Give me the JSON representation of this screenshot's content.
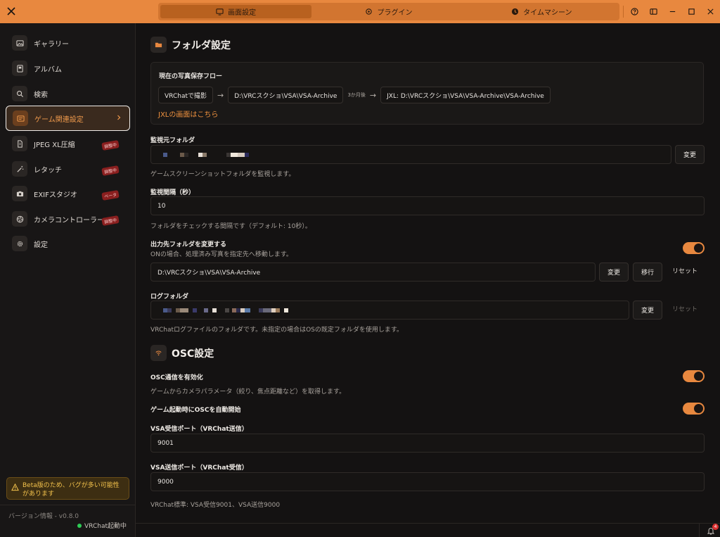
{
  "titlebar": {
    "tabs": [
      {
        "label": "画面設定",
        "icon": "monitor-icon",
        "active": true
      },
      {
        "label": "プラグイン",
        "icon": "puzzle-icon",
        "active": false
      },
      {
        "label": "タイムマシーン",
        "icon": "clock-icon",
        "active": false
      }
    ],
    "icons": [
      "help-icon",
      "sidebar-toggle-icon",
      "minimize-icon",
      "maximize-icon",
      "close-icon"
    ]
  },
  "sidebar": {
    "items": [
      {
        "label": "ギャラリー",
        "icon": "image-icon"
      },
      {
        "label": "アルバム",
        "icon": "album-icon"
      },
      {
        "label": "検索",
        "icon": "search-icon"
      },
      {
        "label": "ゲーム関連設定",
        "icon": "game-icon",
        "active": true
      },
      {
        "label": "JPEG XL圧縮",
        "icon": "file-icon",
        "badge": "調整中"
      },
      {
        "label": "レタッチ",
        "icon": "wand-icon",
        "badge": "調整中"
      },
      {
        "label": "EXIFスタジオ",
        "icon": "camera-icon",
        "badge": "ベータ"
      },
      {
        "label": "カメラコントローラー",
        "icon": "aperture-icon",
        "badge": "調整中"
      },
      {
        "label": "設定",
        "icon": "gear-icon"
      }
    ],
    "beta_notice": "Beta版のため、バグが多い可能性があります",
    "version": "バージョン情報 - v0.8.0",
    "vrchat_status": "VRChat起動中",
    "status_color": "#2ecc55"
  },
  "folder_section": {
    "title": "フォルダ設定",
    "flow_title": "現在の写真保存フロー",
    "flow": {
      "step1": "VRChatで撮影",
      "step2": "D:\\VRCスクショ\\VSA\\VSA-Archive",
      "delay": "3か月後",
      "step3": "JXL: D:\\VRCスクショ\\VSA\\VSA-Archive\\VSA-Archive"
    },
    "jxl_link": "JXLの画面はこちら",
    "watch_folder": {
      "label": "監視元フォルダ",
      "change": "変更",
      "desc": "ゲームスクリーンショットフォルダを監視します。"
    },
    "interval": {
      "label": "監視間隔（秒）",
      "value": "10",
      "desc": "フォルダをチェックする間隔です（デフォルト: 10秒）。"
    },
    "output": {
      "label": "出力先フォルダを変更する",
      "desc": "ONの場合、処理済み写真を指定先へ移動します。",
      "enabled": true,
      "value": "D:\\VRCスクショ\\VSA\\VSA-Archive",
      "change": "変更",
      "move": "移行",
      "reset": "リセット"
    },
    "log": {
      "label": "ログフォルダ",
      "change": "変更",
      "reset": "リセット",
      "desc": "VRChatログファイルのフォルダです。未指定の場合はOSの既定フォルダを使用します。"
    }
  },
  "osc_section": {
    "title": "OSC設定",
    "enable": {
      "label": "OSC通信を有効化",
      "desc": "ゲームからカメラパラメータ（絞り、焦点距離など）を取得します。",
      "enabled": true
    },
    "autostart": {
      "label": "ゲーム起動時にOSCを自動開始",
      "enabled": true
    },
    "recv_port": {
      "label": "VSA受信ポート（VRChat送信）",
      "value": "9001"
    },
    "send_port": {
      "label": "VSA送信ポート（VRChat受信）",
      "value": "9000"
    },
    "note": "VRChat標準: VSA受信9001、VSA送信9000"
  },
  "notifications": {
    "count": "4"
  },
  "colors": {
    "accent": "#e8883f",
    "link": "#f0923f",
    "warning": "#f3c24c",
    "badge": "#8a1f1f"
  }
}
